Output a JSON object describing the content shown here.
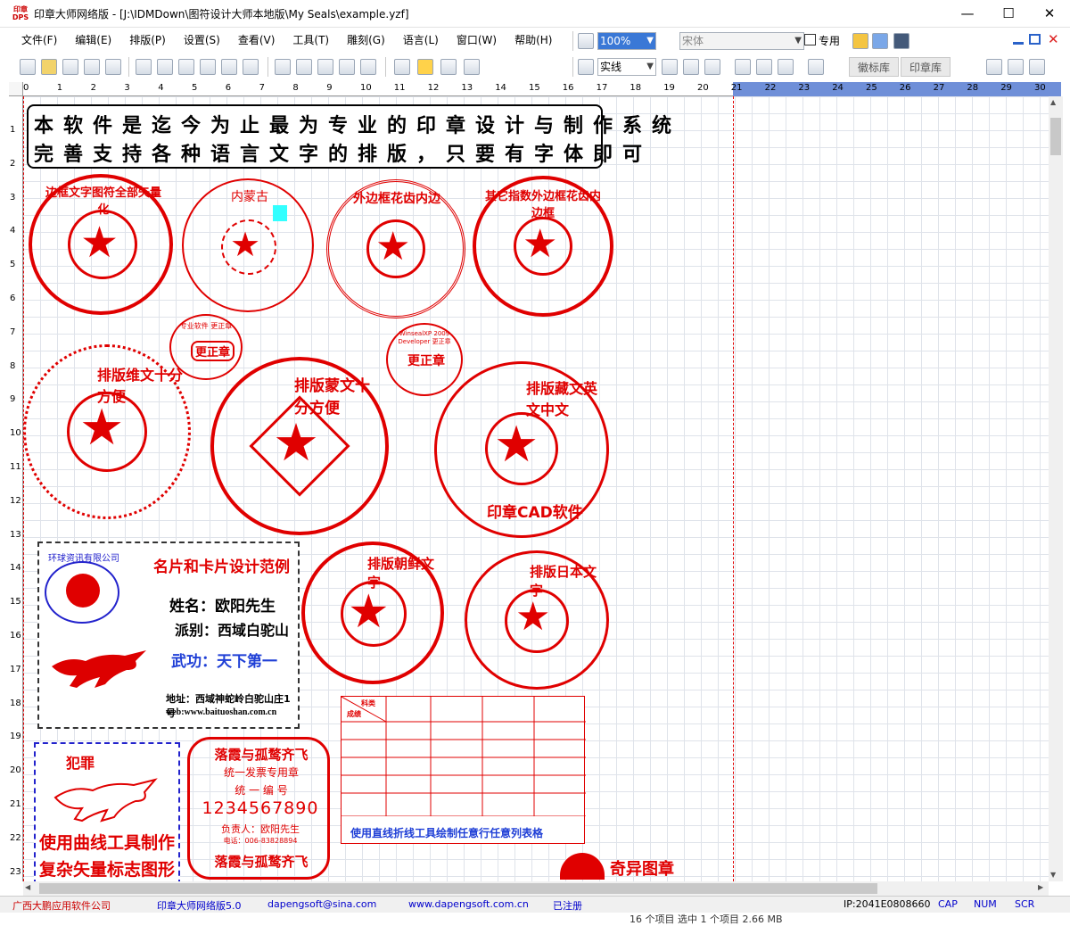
{
  "window": {
    "app_logo": "印章\nDPS",
    "title": "印章大师网络版 - [J:\\IDMDown\\图符设计大师本地版\\My Seals\\example.yzf]",
    "minimize": "—",
    "maximize": "☐",
    "close": "✕"
  },
  "menu": [
    "文件(F)",
    "编辑(E)",
    "排版(P)",
    "设置(S)",
    "查看(V)",
    "工具(T)",
    "雕刻(G)",
    "语言(L)",
    "窗口(W)",
    "帮助(H)"
  ],
  "toolbar": {
    "zoom": "100%",
    "font": "宋体",
    "dedicated_label": "专用",
    "line_style": "实线"
  },
  "tabs": [
    "徽标库",
    "印章库"
  ],
  "ruler": {
    "h_ticks": [
      "0",
      "1",
      "2",
      "3",
      "4",
      "5",
      "6",
      "7",
      "8",
      "9",
      "10",
      "11",
      "12",
      "13",
      "14",
      "15",
      "16",
      "17",
      "18",
      "19",
      "20",
      "21",
      "22",
      "23",
      "24",
      "25",
      "26",
      "27",
      "28",
      "29",
      "30"
    ],
    "v_ticks": [
      "1",
      "2",
      "3",
      "4",
      "5",
      "6",
      "7",
      "8",
      "9",
      "10",
      "11",
      "12",
      "13",
      "14",
      "15",
      "16",
      "17",
      "18",
      "19",
      "20",
      "21",
      "22",
      "23"
    ]
  },
  "canvas": {
    "banner_line1": "本软件是迄今为止最为专业的印章设计与制作系统",
    "banner_line2": "完善支持各种语言文字的排版，只要有字体即可",
    "seals": [
      {
        "text": "边框文字图符全部矢量化"
      },
      {
        "text": "内蒙古"
      },
      {
        "text": "外边框花齿内边"
      },
      {
        "text": "其它指数外边框花齿内边框"
      },
      {
        "text": "更正章"
      },
      {
        "text": "更正章"
      },
      {
        "text": "排版维文十分方便"
      },
      {
        "text": "排版蒙文十分方便"
      },
      {
        "text": "排版藏文英文中文"
      },
      {
        "text": "印章CAD软件"
      },
      {
        "text": "排版朝鲜文字"
      },
      {
        "text": "排版日本文字"
      }
    ],
    "small_seal_a": "专业软件 更正章",
    "small_seal_b": "WinsealXP 2009 Developer 更正章",
    "card": {
      "company": "环球资讯有限公司",
      "title": "名片和卡片设计范例",
      "name": "姓名：欧阳先生",
      "sect": "派别：西域白驼山",
      "skill": "武功：天下第一",
      "address": "地址：西域神蛇岭白驼山庄1号",
      "web": "web:www.baituoshan.com.cn"
    },
    "stamp": {
      "top_text": "犯罪",
      "line1": "使用曲线工具制作",
      "line2": "复杂矢量标志图形"
    },
    "invoice_seal": {
      "top": "落霞与孤鹜齐飞",
      "line1": "统一发票专用章",
      "line2": "统 一 编 号",
      "number": "1234567890",
      "person": "负责人：欧阳先生",
      "phone": "电话：006-83828894",
      "bottom": "落霞与孤鹜齐飞"
    },
    "table": {
      "corner_a": "科类",
      "corner_b": "成绩",
      "caption": "使用直线折线工具绘制任意行任意列表格"
    },
    "strange": "奇异图章"
  },
  "status": {
    "company": "广西大鹏应用软件公司",
    "product": "印章大师网络版5.0",
    "email": "dapengsoft@sina.com",
    "web": "www.dapengsoft.com.cn",
    "registered": "已注册",
    "ip": "IP:2041E0808660",
    "cap": "CAP",
    "num": "NUM",
    "scr": "SCR"
  },
  "explorer_hint": "16 个项目    选中 1 个项目  2.66 MB",
  "colors": {
    "seal_red": "#e00000",
    "ruler_blue": "#6f8fd8",
    "grid": "#dfe3ea",
    "link_blue": "#0000cc"
  }
}
